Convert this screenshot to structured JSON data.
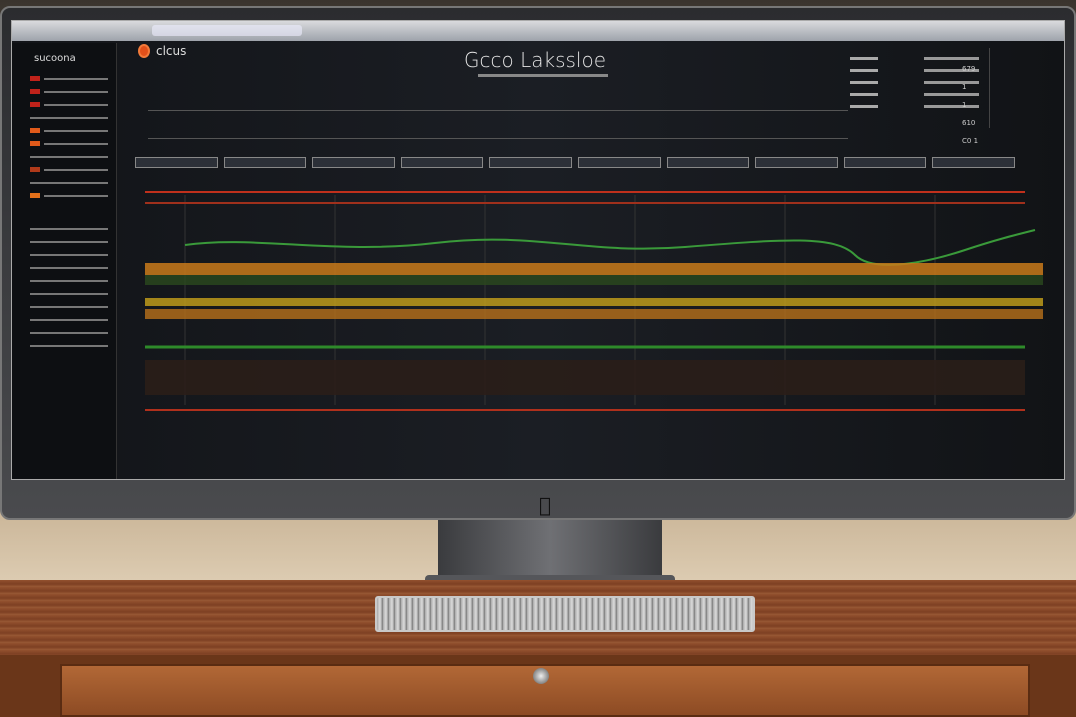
{
  "app": {
    "logo_text": "clcus",
    "title": "Gcco Lakssloe",
    "sidebar_title": "sucoona"
  },
  "colors": {
    "accent": "#e2501a",
    "series_red": "#c0301c",
    "series_orange": "#d4881e",
    "series_yellow": "#c8a21a",
    "series_green": "#2e8a2a"
  },
  "right_panel": {
    "values": [
      "679",
      "1",
      "1",
      "610",
      "C0 1"
    ]
  },
  "chart_data": {
    "type": "line",
    "title": "",
    "xlabel": "",
    "ylabel": "",
    "series_count": 6,
    "grid": true
  }
}
